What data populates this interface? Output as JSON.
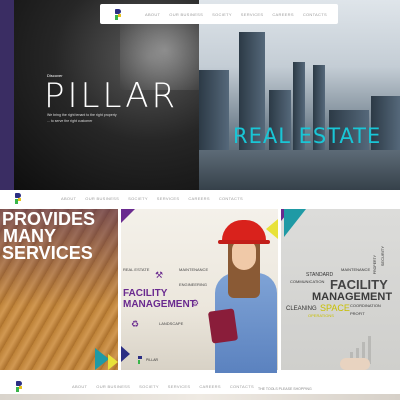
{
  "nav": {
    "items": [
      "ABOUT",
      "OUR BUSINESS",
      "SOCIETY",
      "SERVICES",
      "CAREERS",
      "CONTACTS"
    ]
  },
  "hero": {
    "discover": "Discover",
    "brand": "PILLAR",
    "tagline_1": "We bring the right tenant     to the right property",
    "tagline_2": "... to serve the right customer",
    "real_estate": "REAL ESTATE"
  },
  "services": {
    "lines": [
      "PROVIDES",
      "MANY",
      "SERVICES"
    ]
  },
  "facility": {
    "facility": "FACILITY",
    "management": "MANAGEMENT",
    "real_estate": "REAL ESTATE",
    "maintenance": "MAINTENANCE",
    "engineering": "ENGINEERING",
    "landscape": "LANDSCAPE",
    "logo_text": "PILLAR"
  },
  "management_panel": {
    "standard": "STANDARD",
    "maintenance": "MAINTENANCE",
    "security": "SECURITY",
    "property": "PROPERTY",
    "communication": "COMMUNICATION",
    "facility": "FACILITY",
    "management": "MANAGEMENT",
    "cleaning": "CLEANING",
    "space": "SPACE",
    "coordination": "COORDINATION",
    "operations": "OPERATIONS",
    "profit": "PROFIT"
  },
  "footer_caption": "THE TOOLS PLEASE SHOPPING",
  "colors": {
    "brand_purple": "#2b2e83",
    "accent_teal": "#19c6d6",
    "facility_purple": "#6a2a8f",
    "triangle_teal": "#1f9aa5",
    "triangle_yellow": "#e8e23a"
  }
}
